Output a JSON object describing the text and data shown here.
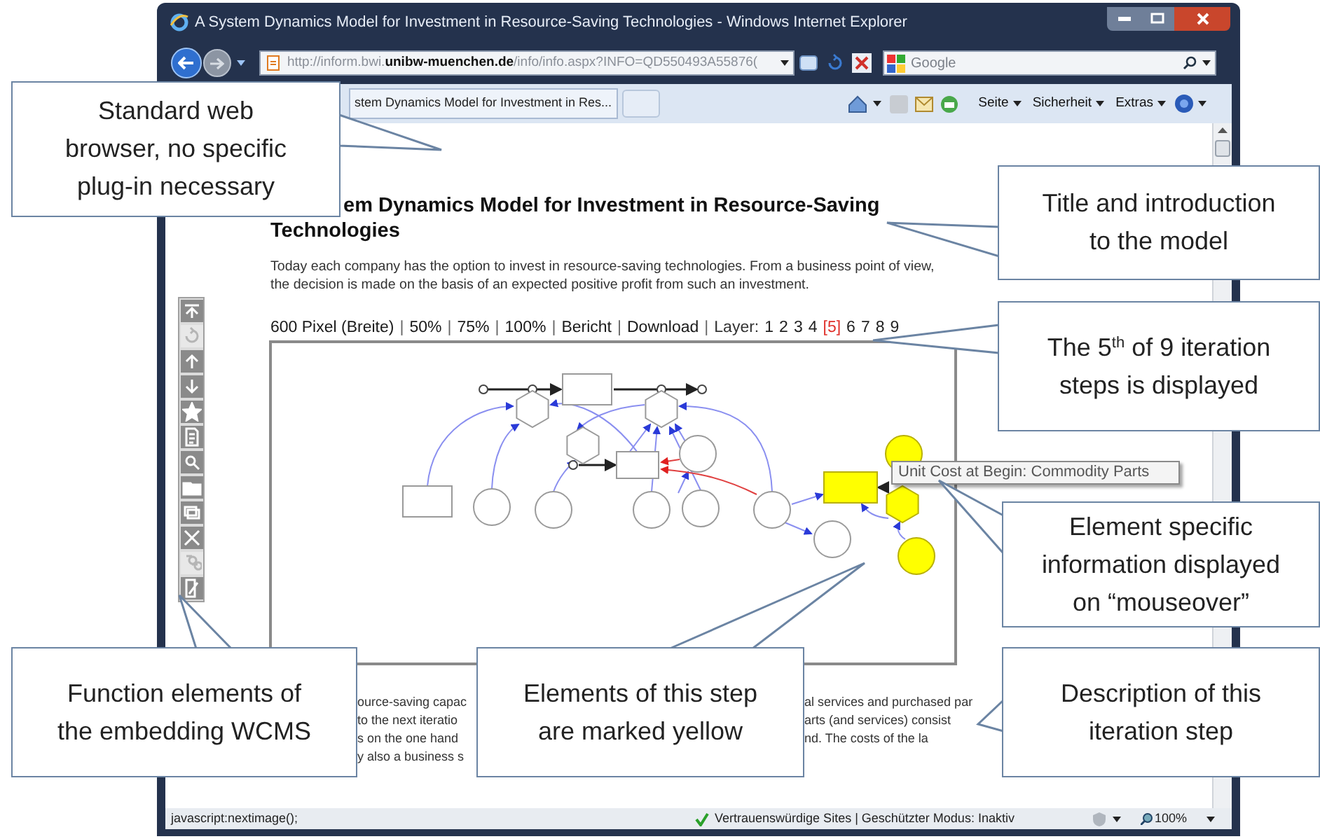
{
  "window": {
    "title": "A System Dynamics Model for Investment in Resource-Saving Technologies - Windows Internet Explorer"
  },
  "address_bar": {
    "url": "http://inform.bwi.**unibw-muenchen.de**/info/info.aspx?INFO=QD550493A55876("
  },
  "search_box": {
    "placeholder": "Google"
  },
  "tab": {
    "title": "stem Dynamics Model for Investment in Res..."
  },
  "command_bar": [
    "Seite",
    "Sicherheit",
    "Extras"
  ],
  "page": {
    "title": [
      "em Dynamics Model for Investment in Resource-Saving",
      "Technologies"
    ],
    "intro": [
      "Today each company has the option to invest in resource-saving technologies. From a business point of view,",
      "the decision is made on the basis of an expected positive profit from such an investment."
    ],
    "links_row": [
      {
        "kind": "link",
        "text": "600 Pixel (Breite)"
      },
      {
        "kind": "separator",
        "text": "|"
      },
      {
        "kind": "link",
        "text": "50%"
      },
      {
        "kind": "separator",
        "text": "|"
      },
      {
        "kind": "link",
        "text": "75%"
      },
      {
        "kind": "separator",
        "text": "|"
      },
      {
        "kind": "link",
        "text": "100%"
      },
      {
        "kind": "separator",
        "text": "|"
      },
      {
        "kind": "link",
        "text": "Bericht"
      },
      {
        "kind": "separator",
        "text": "|"
      },
      {
        "kind": "link",
        "text": "Download"
      },
      {
        "kind": "separator",
        "text": "|"
      },
      {
        "kind": "label",
        "text": "Layer:"
      }
    ],
    "layers": [
      {
        "label": "1",
        "selected": false
      },
      {
        "label": "2",
        "selected": false
      },
      {
        "label": "3",
        "selected": false
      },
      {
        "label": "4",
        "selected": false
      },
      {
        "label": "[5]",
        "selected": true
      },
      {
        "label": "6",
        "selected": false
      },
      {
        "label": "7",
        "selected": false
      },
      {
        "label": "8",
        "selected": false
      },
      {
        "label": "9",
        "selected": false
      }
    ],
    "diagram": {
      "nodes": [
        {
          "kind": "stock",
          "highlighted": false
        },
        {
          "kind": "stock",
          "highlighted": false
        },
        {
          "kind": "stock",
          "highlighted": false
        },
        {
          "kind": "hexagon",
          "highlighted": false
        },
        {
          "kind": "hexagon",
          "highlighted": false
        },
        {
          "kind": "hexagon",
          "highlighted": false
        },
        {
          "kind": "circle",
          "highlighted": false
        },
        {
          "kind": "circle",
          "highlighted": false
        },
        {
          "kind": "circle",
          "highlighted": false
        },
        {
          "kind": "circle",
          "highlighted": false
        },
        {
          "kind": "circle",
          "highlighted": false
        },
        {
          "kind": "circle",
          "highlighted": false
        },
        {
          "kind": "circle",
          "highlighted": false
        },
        {
          "kind": "stock",
          "highlighted": true
        },
        {
          "kind": "circle",
          "highlighted": true
        },
        {
          "kind": "hexagon",
          "highlighted": true
        },
        {
          "kind": "circle",
          "highlighted": true
        }
      ],
      "tooltip": "Unit Cost at Begin: Commodity Parts"
    },
    "description_left": [
      "ource-saving capac",
      "to the next iteratio",
      "s on the one hand",
      "y also a business s"
    ],
    "description_right": [
      "al services and purchased par",
      "arts (and services) consist",
      "nd. The costs of the la"
    ]
  },
  "wcms_toolbar": [
    {
      "kind": "top",
      "disabled": false
    },
    {
      "kind": "refresh",
      "disabled": true
    },
    {
      "kind": "up",
      "disabled": false
    },
    {
      "kind": "down",
      "disabled": false
    },
    {
      "kind": "star",
      "disabled": false
    },
    {
      "kind": "page",
      "disabled": false
    },
    {
      "kind": "search",
      "disabled": false
    },
    {
      "kind": "folder",
      "disabled": false
    },
    {
      "kind": "stack",
      "disabled": false
    },
    {
      "kind": "close",
      "disabled": false
    },
    {
      "kind": "gears",
      "disabled": true
    },
    {
      "kind": "edit",
      "disabled": false
    }
  ],
  "status_bar": {
    "text": "javascript:nextimage();",
    "zone": "Vertrauenswürdige Sites | Geschützter Modus: Inaktiv",
    "zoom": "100%"
  },
  "callouts": [
    {
      "text": "Standard web\nbrowser, no specific\nplug-in necessary"
    },
    {
      "text": "Title and introduction\nto the model"
    },
    {
      "text": "The 5$^{th}$ of 9 iteration\nsteps is displayed"
    },
    {
      "text": "Element specific\ninformation displayed\non “mouseover”"
    },
    {
      "text": "Function elements  of\nthe embedding WCMS"
    },
    {
      "text": "Elements of this step\nare marked yellow"
    },
    {
      "text": "Description of this\niteration step"
    }
  ]
}
